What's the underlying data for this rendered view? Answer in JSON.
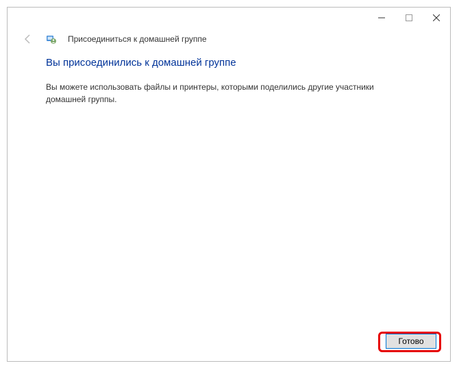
{
  "window": {
    "title": "Присоединиться к домашней группе"
  },
  "content": {
    "heading": "Вы присоединились к домашней группе",
    "body": "Вы можете использовать файлы и принтеры, которыми поделились другие участники домашней группы."
  },
  "footer": {
    "done_label": "Готово"
  }
}
